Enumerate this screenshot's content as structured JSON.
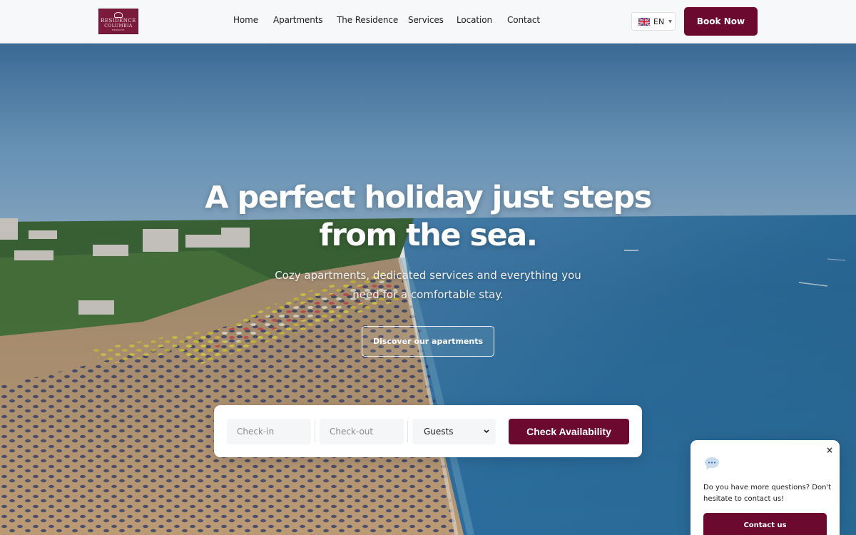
{
  "brand": {
    "logo_line1": "RESIDENCE",
    "logo_line2": "COLUMBIA",
    "logo_line3": "BIBIONE",
    "color": "#6b0a2e"
  },
  "nav": {
    "items": [
      {
        "label": "Home"
      },
      {
        "label": "Apartments"
      },
      {
        "label": "The Residence"
      },
      {
        "label": "Services"
      },
      {
        "label": "Location"
      },
      {
        "label": "Contact"
      }
    ]
  },
  "language": {
    "code": "EN",
    "flag_icon": "uk-flag-icon"
  },
  "header": {
    "book_label": "Book Now"
  },
  "hero": {
    "title": "A perfect holiday just steps from the sea.",
    "subtitle": "Cozy apartments, dedicated services and everything you need for a comfortable stay.",
    "cta_label": "Discover our apartments"
  },
  "booking": {
    "checkin_placeholder": "Check-in",
    "checkout_placeholder": "Check-out",
    "guests_label": "Guests",
    "submit_label": "Check Availability"
  },
  "chat": {
    "message": "Do you have more questions? Don't hesitate to contact us!",
    "button_label": "Contact us",
    "close_symbol": "×",
    "icon": "chat-bubble-icon"
  }
}
